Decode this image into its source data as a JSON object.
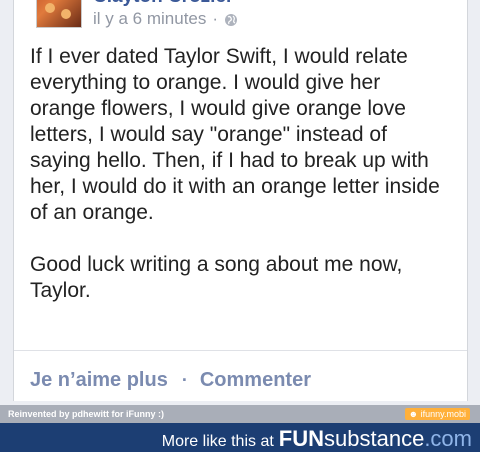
{
  "post": {
    "author": "Clayton Crozier",
    "timestamp": "il y a 6 minutes",
    "separator": "·",
    "paragraph1": "If I ever dated Taylor Swift, I would relate everything to orange. I would give her orange flowers, I would give orange love letters, I would say \"orange\" instead of saying hello. Then, if I had to break up with her, I would do it with an orange letter inside of an orange.",
    "paragraph2": "Good luck writing a song about me now, Taylor."
  },
  "actions": {
    "unlike_label": "Je n’aime plus",
    "separator": "·",
    "comment_label": "Commenter"
  },
  "watermark": {
    "credit": "Reinvented by pdhewitt for iFunny :)",
    "site_badge": "☻ ifunny.mobi"
  },
  "footer": {
    "more_text": "More like this at",
    "brand_fun": "FUN",
    "brand_sub": "substance",
    "brand_tld": ".com"
  },
  "colors": {
    "link_blue": "#3b5998",
    "action_blue": "#7b8bb0",
    "footer_bg": "#1c3e73",
    "ifunny_orange": "#ffb03a"
  },
  "icons": {
    "globe": "globe-icon"
  }
}
